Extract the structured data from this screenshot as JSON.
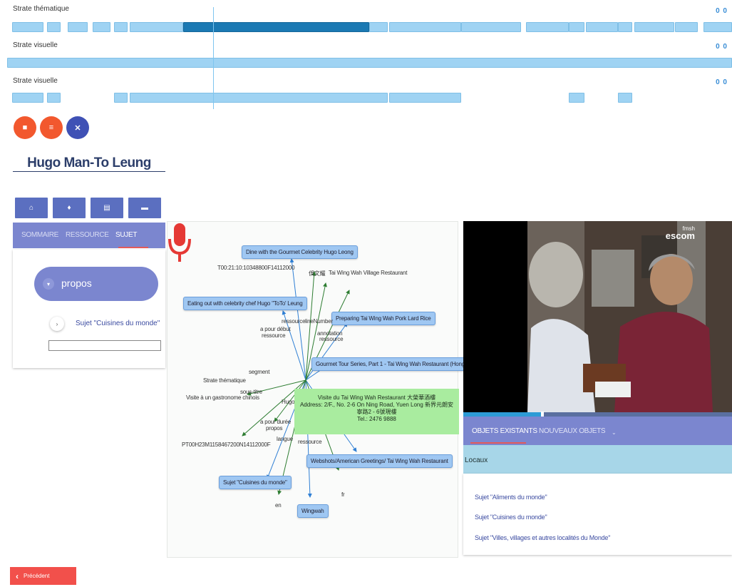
{
  "strata": [
    {
      "label": "Strate thématique",
      "controls": "0 0"
    },
    {
      "label": "Strate visuelle",
      "controls": "0 0"
    },
    {
      "label": "Strate visuelle",
      "controls": "0 0"
    }
  ],
  "actions": {
    "btn1": "■",
    "btn2": "≡",
    "close": "✕"
  },
  "person": {
    "name": "Hugo Man-To Leung"
  },
  "toolbar": {
    "home": "⌂",
    "mic": "♦",
    "list": "▤",
    "doc": "▬"
  },
  "left_tabs": {
    "summary": "SOMMAIRE",
    "resource": "RESSOURCE",
    "subject": "SUJET"
  },
  "left_card": {
    "propos_label": "propos",
    "subject_label": "Sujet \"Cuisines du monde\"",
    "expand": "▾",
    "subject_toggle": "›"
  },
  "graph": {
    "mic_caption": "Strate thématique",
    "nodes": {
      "dine": "Dine with the Gourmet Celebrity Hugo Leong",
      "eating": "Eating out with celebrity chef Hugo \"ToTo' Leung",
      "preparing": "Preparing Tai Wing Wah Pork Lard Rice",
      "gourmet": "Gourmet Tour Series, Part 1 - Tai Wing Wah Restaurant (Hong Kong)",
      "websho": "Webshots/American Greetings/ Tai Wing Wah Restaurant",
      "sujet": "Sujet \"Cuisines du monde\"",
      "wingwah": "Wingwah"
    },
    "labels": {
      "timecode": "T00:21:10:10348800F14112000",
      "chinese_name": "俁文耀",
      "village": "Tai Wing Wah Village Restaurant",
      "ressource1": "ressource",
      "linenumber": "lineNumber",
      "a_pour_debut": "a pour début",
      "ressource2": "ressource",
      "annotation": "annotation",
      "ressource3": "ressource",
      "segment": "segment",
      "sous_titre": "sous-titre",
      "visite": "Visite à un gastronome chinois",
      "hugo": "Hugo",
      "a_pour_duree": "a pour durée",
      "propos": "propos",
      "langue": "langue",
      "ressource4": "ressource",
      "duration": "PT00H23M1158467200N14112000F",
      "en": "en",
      "fr": "fr"
    },
    "info_box": {
      "line1": "Visite du  Tai Wing Wah Restaurant   大榮華酒樓",
      "line2": "Address: 2/F., No. 2-6 On Ning Road, Yuen Long  新界元朗安寧路2 - 6號現樓",
      "line3": "Tel.: 2476 9888"
    }
  },
  "video": {
    "logo_top": "fmsh",
    "logo_main": "escom",
    "progress": 0.29
  },
  "right_tabs": {
    "existing": "OBJETS EXISTANTS",
    "new": "NOUVEAUX OBJETS",
    "caret": "⌄"
  },
  "locaux_label": "Locaux",
  "right_items": [
    "Sujet \"Aliments du monde\"",
    "Sujet \"Cuisines du monde\"",
    "Sujet \"Villes, villages et autres localités du Monde\""
  ],
  "previous": {
    "label": "Précédent",
    "chevron": "‹"
  },
  "colors": {
    "accent": "#7b86cf",
    "segment": "#9fd3f3",
    "segment_selected": "#1b79b3",
    "orange": "#f2582e",
    "blue": "#3f51b5",
    "green_box": "#a9ec9f",
    "prev_red": "#f2504b"
  }
}
